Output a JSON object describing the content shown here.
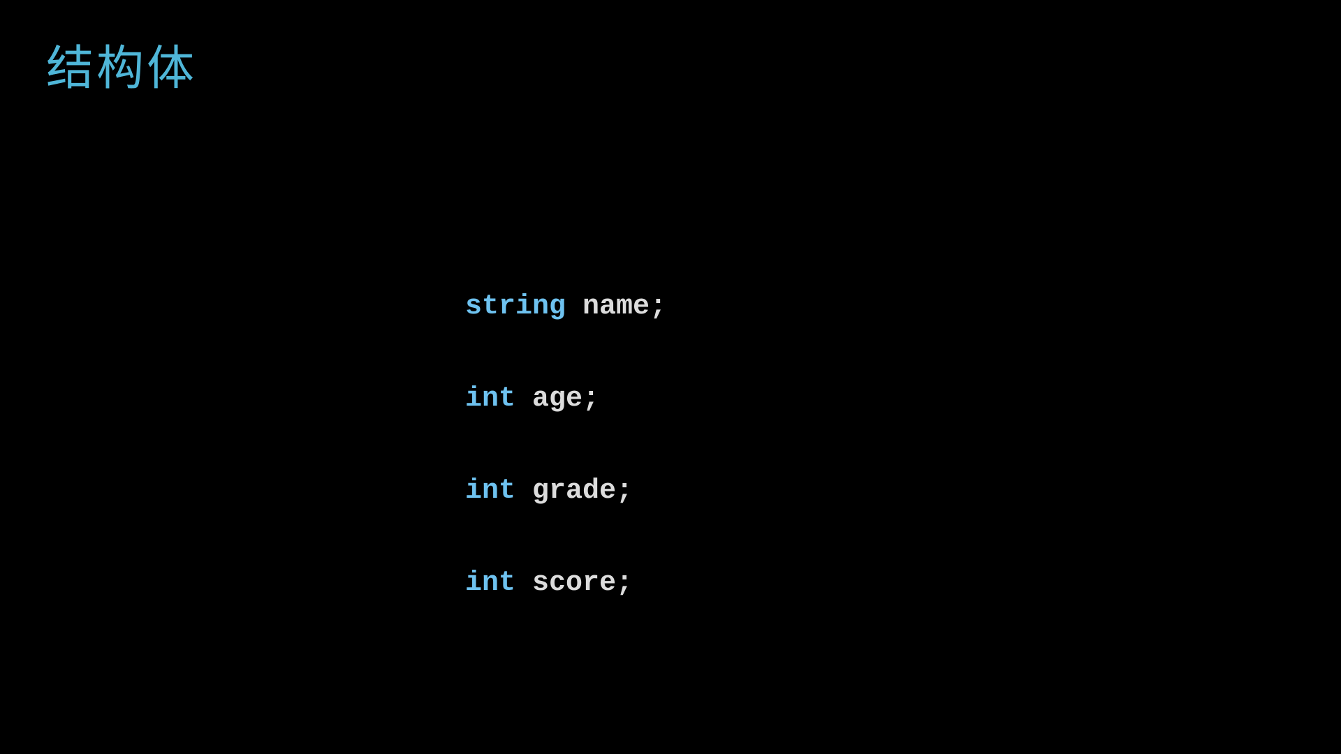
{
  "colors": {
    "background": "#000000",
    "title": "#4fb6d8",
    "keyword": "#6ec2f0",
    "identifier": "#dcdcdc"
  },
  "slide": {
    "title": "结构体"
  },
  "code": {
    "lines": [
      {
        "type": "string",
        "name": "name;"
      },
      {
        "type": "int",
        "name": "age;"
      },
      {
        "type": "int",
        "name": "grade;"
      },
      {
        "type": "int",
        "name": "score;"
      }
    ]
  }
}
